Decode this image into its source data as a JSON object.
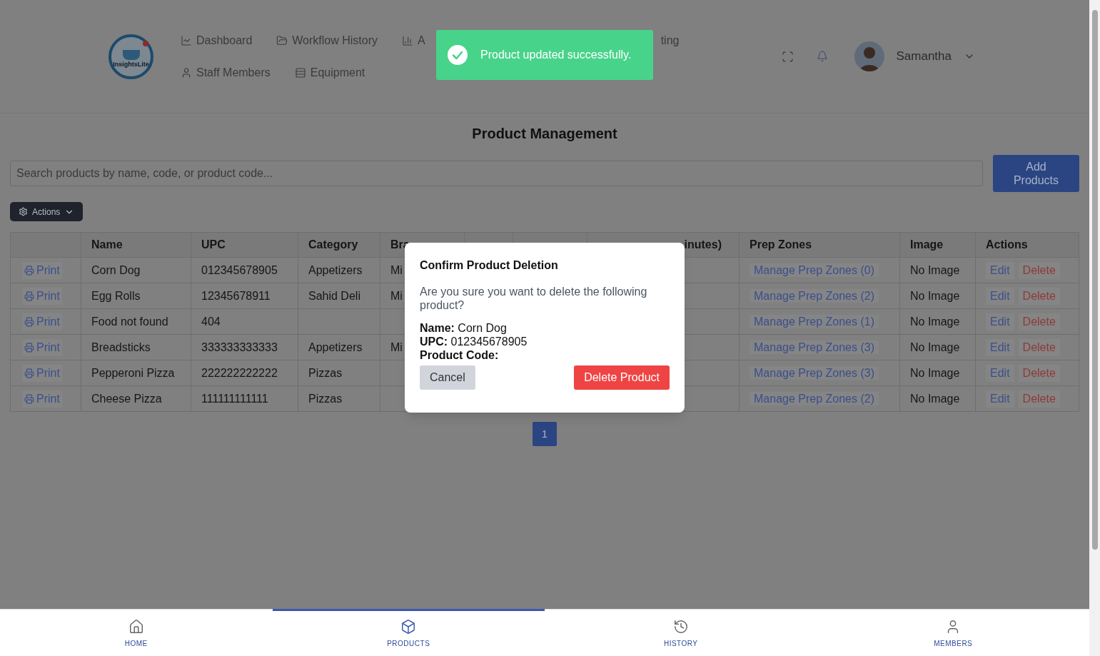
{
  "logo": {
    "text": "InsightsLite"
  },
  "nav": [
    {
      "label": "Dashboard",
      "kind": "chart-line"
    },
    {
      "label": "Workflow History",
      "kind": "folder"
    },
    {
      "label": "A",
      "kind": "bar-chart"
    },
    {
      "label": "ting"
    },
    {
      "label": "Staff Members",
      "kind": "user"
    },
    {
      "label": "Equipment",
      "kind": "list"
    }
  ],
  "user": {
    "name": "Samantha"
  },
  "toast": {
    "message": "Product updated successfully."
  },
  "page_title": "Product Management",
  "search": {
    "placeholder": "Search products by name, code, or product code..."
  },
  "add_button": "Add Products",
  "actions_button": "Actions",
  "table": {
    "columns": [
      "Name",
      "UPC",
      "Category",
      "Bra",
      "inutes)",
      "Prep Zones",
      "Image",
      "Actions"
    ],
    "rows": [
      {
        "print": "Print",
        "name": "Corn Dog",
        "upc": "012345678905",
        "category": "Appetizers",
        "brand": "Mi",
        "prep_zones": "Manage Prep Zones (0)",
        "image": "No Image",
        "edit": "Edit",
        "delete": "Delete"
      },
      {
        "print": "Print",
        "name": "Egg Rolls",
        "upc": "12345678911",
        "category": "Sahid Deli",
        "brand": "Mi",
        "prep_zones": "Manage Prep Zones (2)",
        "image": "No Image",
        "edit": "Edit",
        "delete": "Delete"
      },
      {
        "print": "Print",
        "name": "Food not found",
        "upc": "404",
        "prep_zones": "Manage Prep Zones (1)",
        "image": "No Image",
        "edit": "Edit",
        "delete": "Delete"
      },
      {
        "print": "Print",
        "name": "Breadsticks",
        "upc": "333333333333",
        "category": "Appetizers",
        "brand": "Mi",
        "prep_zones": "Manage Prep Zones (3)",
        "image": "No Image",
        "edit": "Edit",
        "delete": "Delete"
      },
      {
        "print": "Print",
        "name": "Pepperoni Pizza",
        "upc": "222222222222",
        "category": "Pizzas",
        "prep_zones": "Manage Prep Zones (3)",
        "image": "No Image",
        "edit": "Edit",
        "delete": "Delete"
      },
      {
        "print": "Print",
        "name": "Cheese Pizza",
        "upc": "111111111111",
        "category": "Pizzas",
        "prep_zones": "Manage Prep Zones (2)",
        "image": "No Image",
        "edit": "Edit",
        "delete": "Delete"
      }
    ]
  },
  "pagination": [
    {
      "label": "1",
      "selected": true
    }
  ],
  "modal": {
    "title": "Confirm Product Deletion",
    "message": "Are you sure you want to delete the following product?",
    "fields": [
      {
        "label": "Name:",
        "value": "Corn Dog"
      },
      {
        "label": "UPC:",
        "value": "012345678905"
      },
      {
        "label": "Product Code:"
      }
    ],
    "cancel": "Cancel",
    "confirm": "Delete Product"
  },
  "bottom_nav": [
    {
      "label": "HOME",
      "kind": "home",
      "selected": false
    },
    {
      "label": "PRODUCTS",
      "kind": "box",
      "selected": true
    },
    {
      "label": "HISTORY",
      "kind": "history",
      "selected": false
    },
    {
      "label": "MEMBERS",
      "kind": "user",
      "selected": false
    }
  ]
}
